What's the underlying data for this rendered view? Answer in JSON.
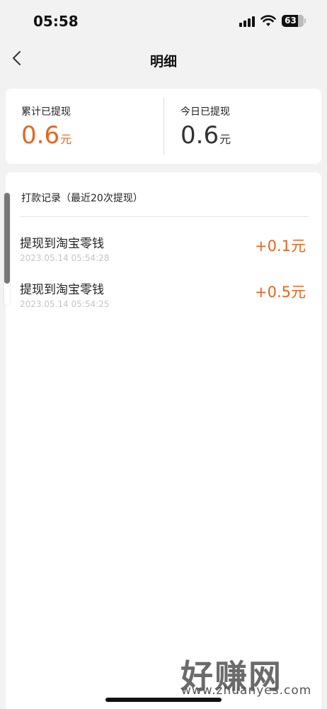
{
  "status_bar": {
    "time": "05:58",
    "battery": "63",
    "icons": [
      "signal-icon",
      "wifi-icon",
      "battery-icon"
    ]
  },
  "nav": {
    "title": "明细",
    "back_icon": "back-chevron-icon"
  },
  "summary": {
    "total": {
      "label": "累计已提现",
      "value": "0.6",
      "unit": "元",
      "color": "#e8641e"
    },
    "today": {
      "label": "今日已提现",
      "value": "0.6",
      "unit": "元",
      "color": "#333333"
    }
  },
  "records": {
    "header": "打款记录（最近20次提现）",
    "items": [
      {
        "title": "提现到淘宝零钱",
        "date": "2023.05.14 05:54:28",
        "amount": "+0.1元"
      },
      {
        "title": "提现到淘宝零钱",
        "date": "2023.05.14 05:54:25",
        "amount": "+0.5元"
      }
    ]
  },
  "watermark": {
    "logo": "好赚网",
    "url": "www.zhuanyes.com"
  },
  "colors": {
    "accent": "#e8641e",
    "background": "#f2f2f2",
    "card": "#ffffff"
  }
}
